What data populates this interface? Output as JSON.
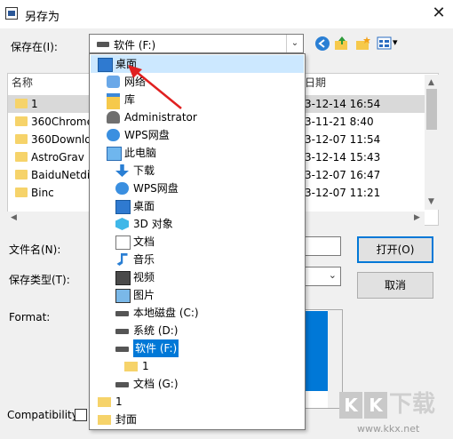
{
  "window": {
    "title": "另存为",
    "close_glyph": "✕"
  },
  "save_in": {
    "label": "保存在(I):",
    "value": "软件 (F:)",
    "arrow": "⌄"
  },
  "toolbar": {
    "icons": [
      "back-icon",
      "up-folder-icon",
      "new-folder-icon",
      "view-menu-icon"
    ],
    "view_arrow": "▾"
  },
  "file_list": {
    "headers": {
      "name": "名称",
      "date": "日期"
    },
    "rows": [
      {
        "name": "1",
        "date": "3-12-14 16:54"
      },
      {
        "name": "360Chrome",
        "date": "3-11-21 8:40"
      },
      {
        "name": "360Downlo",
        "date": "3-12-07 11:54"
      },
      {
        "name": "AstroGrav",
        "date": "3-12-14 15:43"
      },
      {
        "name": "BaiduNetdi",
        "date": "3-12-07 16:47"
      },
      {
        "name": "Binc",
        "date": "3-12-07 11:21"
      }
    ]
  },
  "file_name": {
    "label": "文件名(N):"
  },
  "file_type": {
    "label": "保存类型(T):"
  },
  "format": {
    "label": "Format:"
  },
  "compat": {
    "label": "Compatibility:"
  },
  "buttons": {
    "open": "打开(O)",
    "cancel": "取消"
  },
  "dropdown": {
    "items": [
      {
        "label": "桌面",
        "icon": "desktop-icon",
        "indent": 0
      },
      {
        "label": "网络",
        "icon": "network-icon",
        "indent": 1
      },
      {
        "label": "库",
        "icon": "library-icon",
        "indent": 1
      },
      {
        "label": "Administrator",
        "icon": "user-icon",
        "indent": 1
      },
      {
        "label": "WPS网盘",
        "icon": "cloud-icon",
        "indent": 1
      },
      {
        "label": "此电脑",
        "icon": "computer-icon",
        "indent": 1
      },
      {
        "label": "下载",
        "icon": "download-icon",
        "indent": 2
      },
      {
        "label": "WPS网盘",
        "icon": "cloud-icon",
        "indent": 2
      },
      {
        "label": "桌面",
        "icon": "desktop-icon",
        "indent": 2
      },
      {
        "label": "3D 对象",
        "icon": "cube-icon",
        "indent": 2
      },
      {
        "label": "文档",
        "icon": "document-icon",
        "indent": 2
      },
      {
        "label": "音乐",
        "icon": "music-icon",
        "indent": 2
      },
      {
        "label": "视频",
        "icon": "video-icon",
        "indent": 2
      },
      {
        "label": "图片",
        "icon": "picture-icon",
        "indent": 2
      },
      {
        "label": "本地磁盘 (C:)",
        "icon": "drive-icon",
        "indent": 2
      },
      {
        "label": "系统 (D:)",
        "icon": "drive-icon",
        "indent": 2
      },
      {
        "label": "软件 (F:)",
        "icon": "drive-icon",
        "indent": 2,
        "selected": true
      },
      {
        "label": "1",
        "icon": "folder-icon",
        "indent": 3
      },
      {
        "label": "文档 (G:)",
        "icon": "drive-icon",
        "indent": 2
      },
      {
        "label": "1",
        "icon": "folder-icon",
        "indent": 0
      },
      {
        "label": "封面",
        "icon": "folder-icon",
        "indent": 0
      }
    ]
  },
  "watermark": {
    "brand": "KK",
    "suffix": "下载",
    "url": "www.kkx.net"
  },
  "colors": {
    "accent": "#0078d7",
    "highlight": "#cce8ff",
    "arrow": "#e02020",
    "folder": "#f6d36a"
  }
}
